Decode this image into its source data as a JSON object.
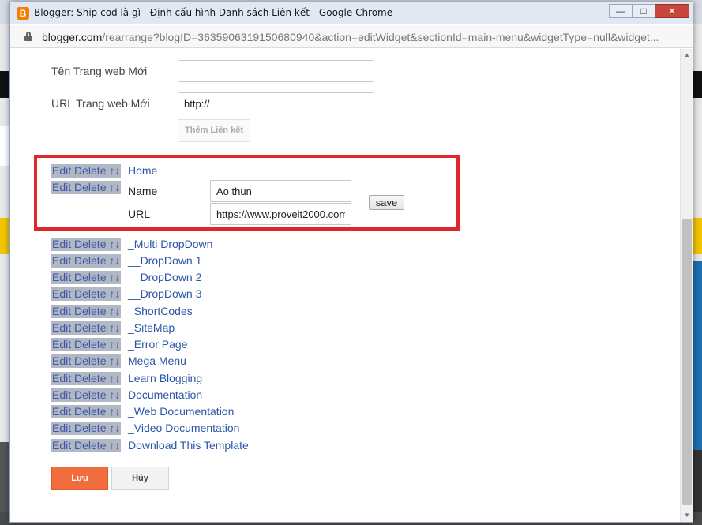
{
  "window": {
    "title": "Blogger: Ship cod là gì - Định cấu hình Danh sách Liên kết - Google Chrome",
    "app_icon": "B",
    "minimize_glyph": "—",
    "maximize_glyph": "□",
    "close_glyph": "✕"
  },
  "address": {
    "host": "blogger.com",
    "path": "/rearrange?blogID=3635906319150680940&action=editWidget&sectionId=main-menu&widgetType=null&widget..."
  },
  "form": {
    "new_site_name_label": "Tên Trang web Mới",
    "new_site_name_value": "",
    "new_site_url_label": "URL Trang web Mới",
    "new_site_url_value": "http://",
    "add_link_button": "Thêm Liên kết"
  },
  "link_actions": {
    "edit": "Edit",
    "delete": "Delete",
    "up": "↑",
    "down": "↓"
  },
  "editing": {
    "name_label": "Name",
    "name_value": "Ao thun",
    "url_label": "URL",
    "url_value": "https://www.proveit2000.com",
    "save_button": "save"
  },
  "links": [
    "Home",
    "_Multi DropDown",
    "__DropDown 1",
    "__DropDown 2",
    "__DropDown 3",
    "_ShortCodes",
    "_SiteMap",
    "_Error Page",
    "Mega Menu",
    "Learn Blogging",
    "Documentation",
    "_Web Documentation",
    "_Video Documentation",
    "Download This Template"
  ],
  "footer": {
    "save_button": "Lưu",
    "cancel_button": "Hủy"
  },
  "colors": {
    "highlight_border": "#e0262c",
    "save_button_bg": "#f26d3d",
    "link_text": "#2b55a5",
    "action_bg": "#b1b8c4"
  }
}
